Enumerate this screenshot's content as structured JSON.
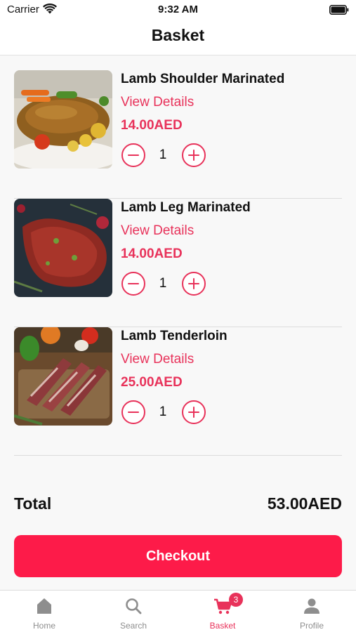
{
  "status_bar": {
    "carrier": "Carrier",
    "time": "9:32 AM"
  },
  "header": {
    "title": "Basket"
  },
  "items": [
    {
      "name": "Lamb Shoulder Marinated",
      "details_label": "View Details",
      "price": "14.00AED",
      "quantity": "1"
    },
    {
      "name": "Lamb Leg Marinated",
      "details_label": "View Details",
      "price": "14.00AED",
      "quantity": "1"
    },
    {
      "name": "Lamb Tenderloin",
      "details_label": "View Details",
      "price": "25.00AED",
      "quantity": "1"
    }
  ],
  "summary": {
    "total_label": "Total",
    "total_value": "53.00AED",
    "checkout_label": "Checkout"
  },
  "tabbar": {
    "tabs": [
      {
        "label": "Home",
        "icon": "home-icon"
      },
      {
        "label": "Search",
        "icon": "search-icon"
      },
      {
        "label": "Basket",
        "icon": "cart-icon",
        "badge": "3",
        "active": true
      },
      {
        "label": "Profile",
        "icon": "profile-icon"
      }
    ]
  },
  "colors": {
    "accent": "#e8325a",
    "checkout_bg": "#fd1b49",
    "tab_inactive": "#8e8e8e"
  }
}
